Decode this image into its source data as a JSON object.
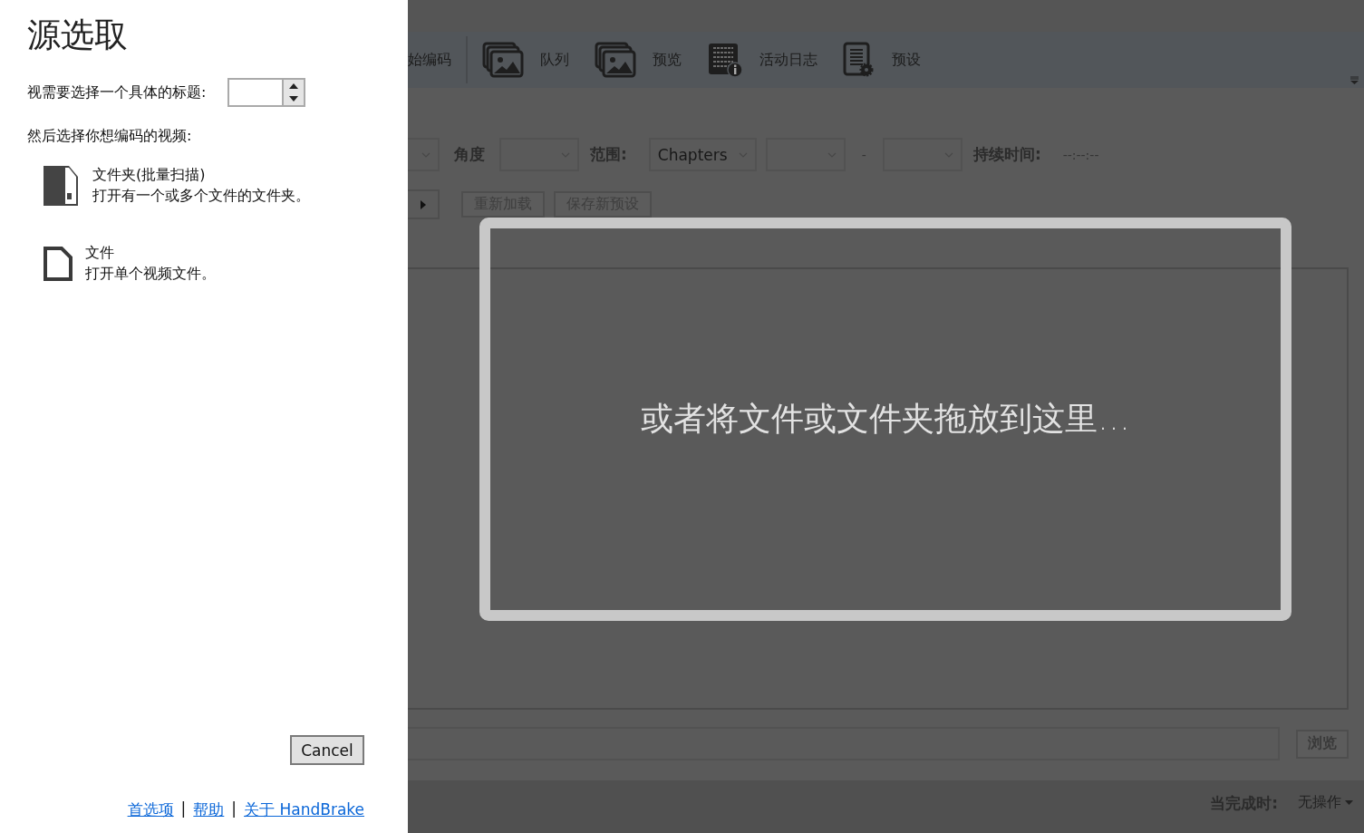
{
  "dialog": {
    "title": "源选取",
    "title_prompt": "视需要选择一个具体的标题:",
    "prompt": "然后选择你想编码的视频:",
    "sources": [
      {
        "kind": "folder",
        "title": "文件夹(批量扫描)",
        "description": "打开有一个或多个文件的文件夹。"
      },
      {
        "kind": "file",
        "title": "文件",
        "description": "打开单个视频文件。"
      }
    ],
    "cancel_button": "Cancel",
    "links": [
      "首选项",
      "帮助",
      "关于 HandBrake"
    ],
    "separators": [
      "|",
      "|"
    ]
  },
  "app": {
    "toolbar": [
      {
        "kind": "text",
        "label": "始编码"
      },
      {
        "kind": "queue",
        "label": "队列"
      },
      {
        "kind": "preview",
        "label": "预览"
      },
      {
        "kind": "log",
        "label": "活动日志"
      },
      {
        "kind": "presets",
        "label": "预设"
      }
    ],
    "source_row": {
      "angle_label": "角度",
      "range_label": "范围:",
      "range_value": "Chapters",
      "dash": "-",
      "duration_label": "持续时间:",
      "duration_value": "--:--:--"
    },
    "preset_buttons": [
      "重新加载",
      "保存新预设"
    ],
    "drop_hint": "或者将文件或文件夹拖放到这里…",
    "browse_button": "浏览",
    "status": {
      "when_done_label": "当完成时:",
      "when_done_value": "无操作"
    }
  }
}
